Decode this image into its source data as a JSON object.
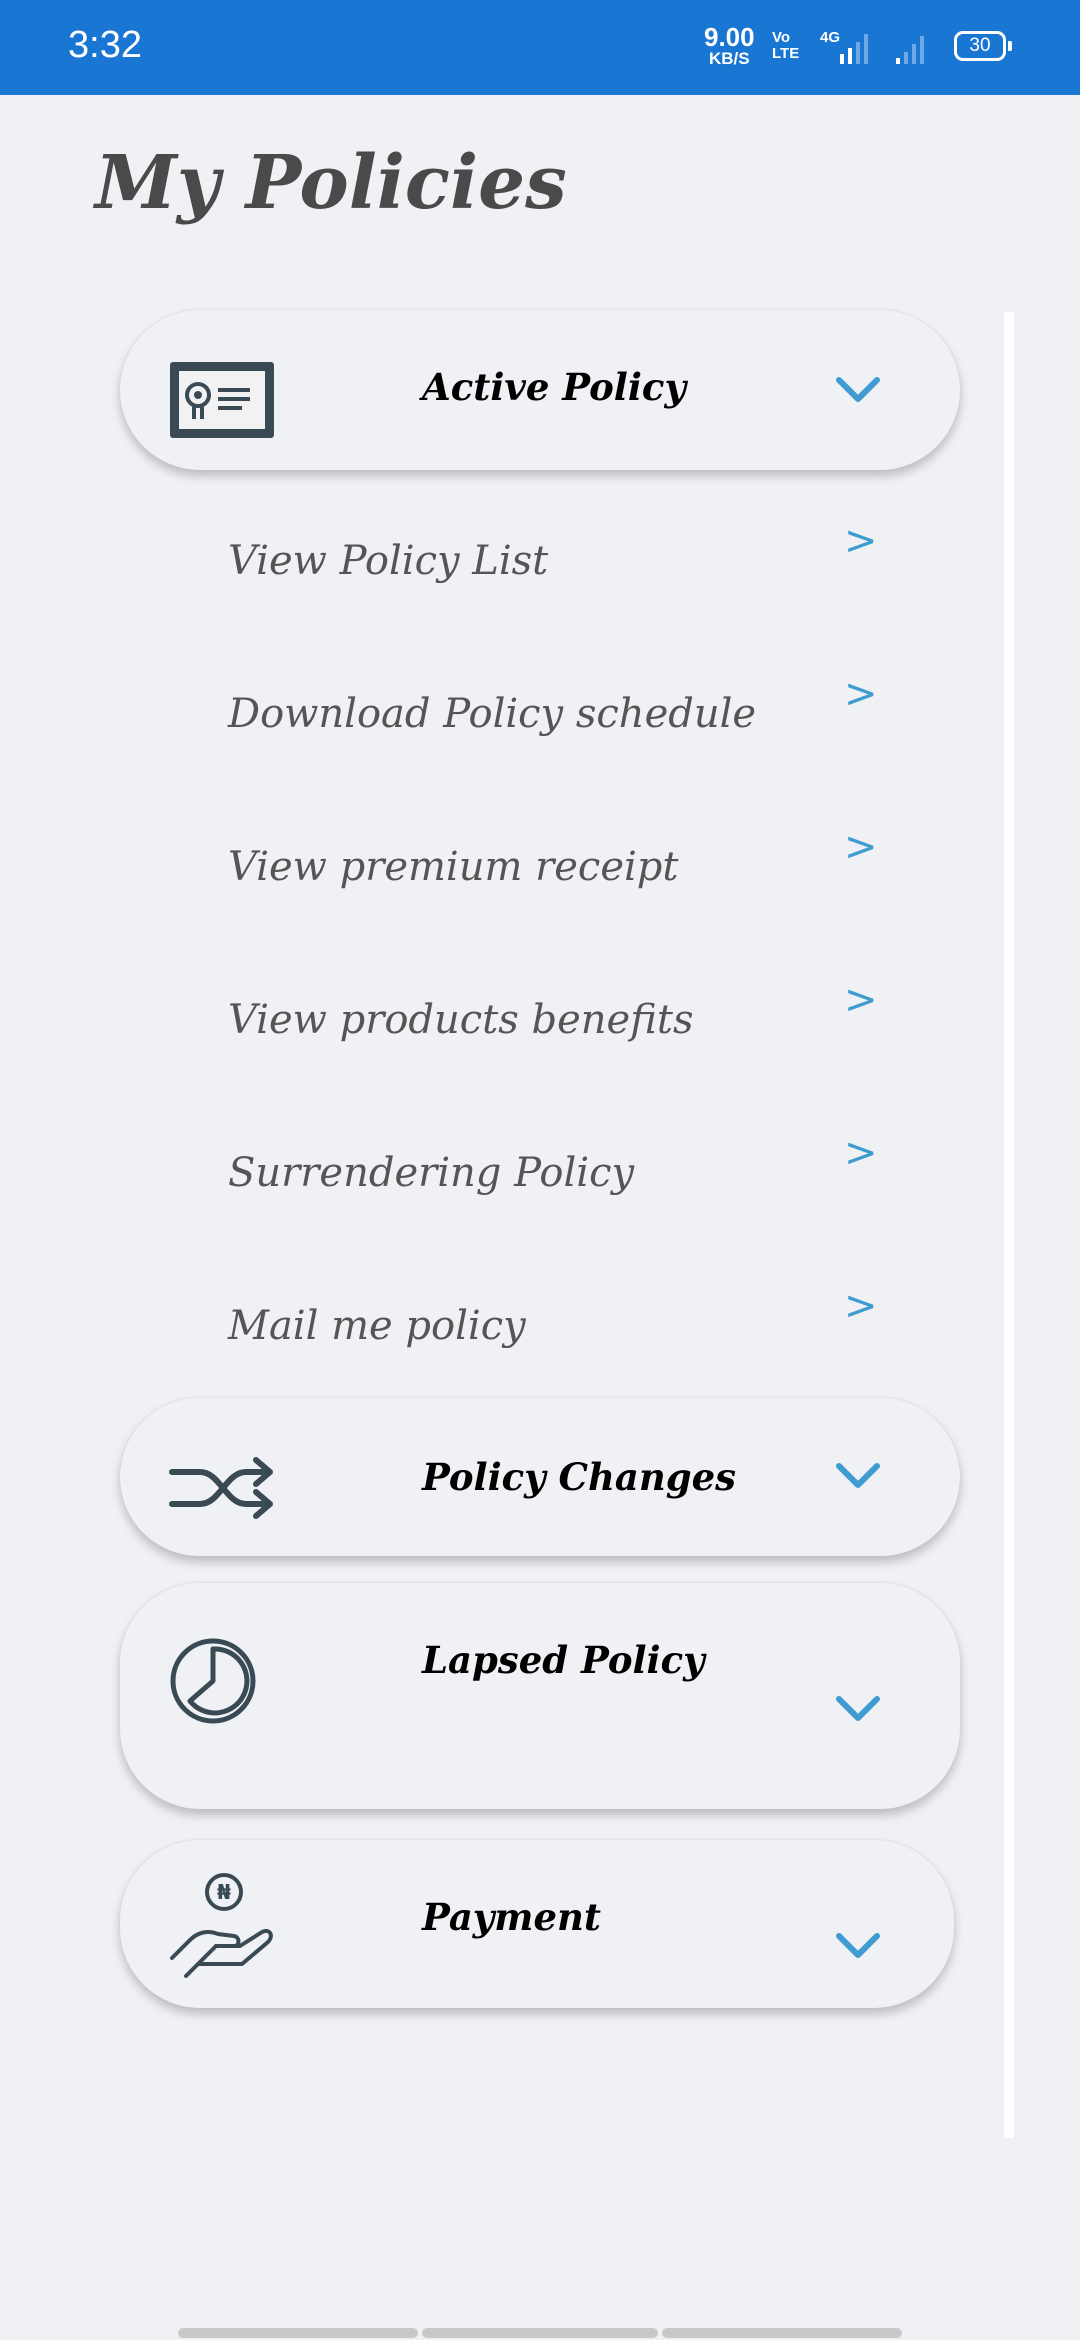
{
  "status_bar": {
    "time": "3:32",
    "net_speed_value": "9.00",
    "net_speed_unit": "KB/S",
    "volte_line1": "Vo",
    "volte_line2": "LTE",
    "network_type": "4G",
    "battery": "30",
    "color": "#1976d2"
  },
  "page": {
    "title": "My Policies"
  },
  "sections": [
    {
      "label": "Active Policy",
      "icon": "certificate-icon",
      "expanded": true,
      "items": [
        {
          "label": "View Policy List",
          "arrow": ">"
        },
        {
          "label": "Download Policy schedule",
          "arrow": ">"
        },
        {
          "label": "View premium receipt",
          "arrow": ">"
        },
        {
          "label": "View products benefits",
          "arrow": ">"
        },
        {
          "label": "Surrendering Policy",
          "arrow": ">"
        },
        {
          "label": "Mail me policy",
          "arrow": ">"
        }
      ]
    },
    {
      "label": "Policy Changes",
      "icon": "shuffle-icon",
      "expanded": false
    },
    {
      "label": "Lapsed Policy",
      "icon": "clock-icon",
      "expanded": false
    },
    {
      "label": "Payment",
      "icon": "hand-coin-icon",
      "expanded": false
    }
  ],
  "colors": {
    "accent": "#3f9bd0",
    "background": "#eff1f5",
    "title": "#4a4a4a"
  }
}
